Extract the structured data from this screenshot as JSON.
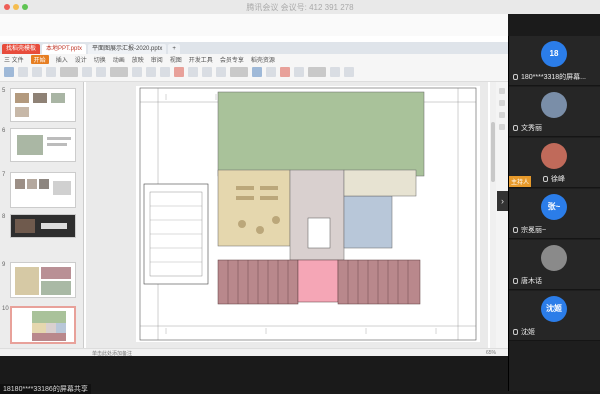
{
  "meeting": {
    "title": "腾讯会议 会议号: 412 391 278"
  },
  "tabs": [
    {
      "label": "找稻壳模板",
      "kind": "home"
    },
    {
      "label": "本地PPT.pptx",
      "kind": "active"
    },
    {
      "label": "平面图展示汇报-2020.pptx",
      "kind": "normal"
    },
    {
      "label": "+",
      "kind": "normal"
    }
  ],
  "menu": [
    "三 文件",
    "开始",
    "插入",
    "设计",
    "切换",
    "动画",
    "放映",
    "审阅",
    "视图",
    "开发工具",
    "会员专享",
    "稻壳资源"
  ],
  "status_bar": {
    "hint": "单击此处添加备注",
    "zoom": "65%"
  },
  "thumbnails": [
    {
      "num": "5"
    },
    {
      "num": "6"
    },
    {
      "num": "7"
    },
    {
      "num": "8"
    },
    {
      "num": "9"
    },
    {
      "num": "10"
    }
  ],
  "participants": [
    {
      "avatar_text": "18",
      "name": "180****3318的屏幕...",
      "avatar_color": "#2b7de9",
      "host": false
    },
    {
      "avatar_text": "",
      "name": "文秀丽",
      "avatar_color": "#7a8ea8",
      "host": false
    },
    {
      "avatar_text": "",
      "name": "徐峰",
      "avatar_color": "#c06a5a",
      "host": true
    },
    {
      "avatar_text": "张~",
      "name": "宗冕丽~",
      "avatar_color": "#2b7de9",
      "host": false
    },
    {
      "avatar_text": "",
      "name": "唐木话",
      "avatar_color": "#8a8a8a",
      "host": false
    },
    {
      "avatar_text": "沈姬",
      "name": "沈姬",
      "avatar_color": "#2b7de9",
      "host": false
    }
  ],
  "host_label": "主持人",
  "speaker": "18180****33186的屏幕共享",
  "floorplan": {
    "green_color": "#a9c29a",
    "yellow_color": "#e5d7ae",
    "grey_color": "#d9d0cf",
    "blue_color": "#b8c7d9",
    "red_color": "#b9888c",
    "pink_color": "#f5a6b6"
  }
}
